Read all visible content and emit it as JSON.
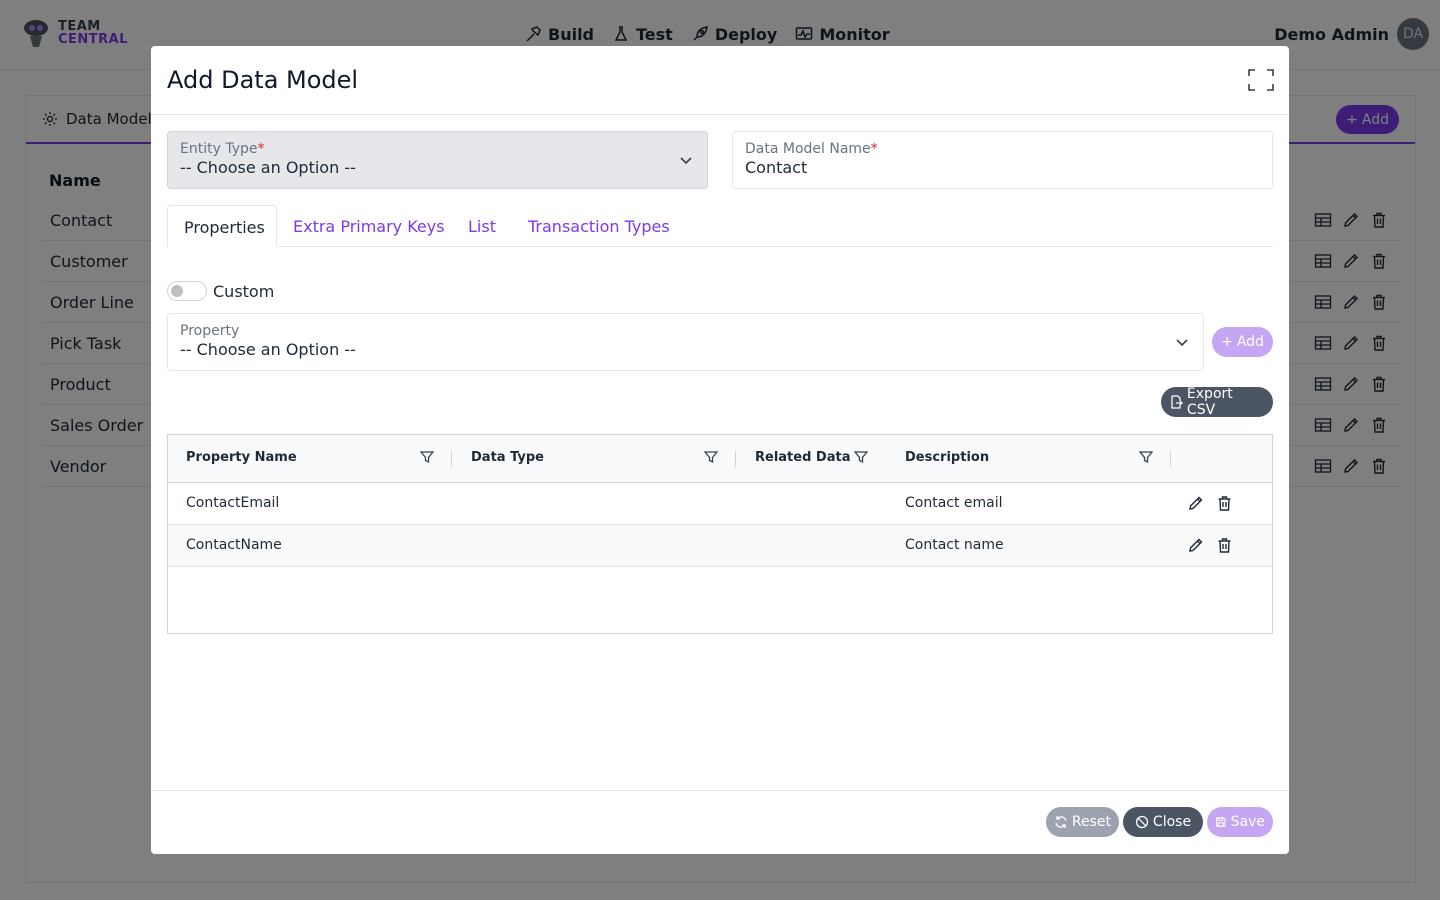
{
  "app": {
    "logo_line1": "TEAM",
    "logo_line2": "CENTRAL",
    "nav": [
      {
        "label": "Build",
        "icon": "hammer-icon"
      },
      {
        "label": "Test",
        "icon": "flask-icon"
      },
      {
        "label": "Deploy",
        "icon": "rocket-icon"
      },
      {
        "label": "Monitor",
        "icon": "monitor-icon"
      }
    ],
    "user_name": "Demo Admin",
    "user_initials": "DA"
  },
  "background": {
    "tab_label": "Data Model",
    "add_label": "Add",
    "column_header": "Name",
    "rows": [
      "Contact",
      "Customer",
      "Order Line",
      "Pick Task",
      "Product",
      "Sales Order",
      "Vendor"
    ]
  },
  "modal": {
    "title": "Add Data Model",
    "entity_type": {
      "label": "Entity Type",
      "required": "*",
      "value": "-- Choose an Option --"
    },
    "data_model_name": {
      "label": "Data Model Name",
      "required": "*",
      "value": "Contact"
    },
    "tabs": [
      "Properties",
      "Extra Primary Keys",
      "List",
      "Transaction Types"
    ],
    "active_tab": "Properties",
    "custom_toggle": {
      "label": "Custom",
      "on": false
    },
    "property": {
      "label": "Property",
      "value": "-- Choose an Option --"
    },
    "add_label": "Add",
    "export_label": "Export CSV",
    "table": {
      "columns": [
        "Property Name",
        "Data Type",
        "Related Data",
        "Description"
      ],
      "rows": [
        {
          "property_name": "ContactEmail",
          "data_type": "",
          "related_data": "",
          "description": "Contact email"
        },
        {
          "property_name": "ContactName",
          "data_type": "",
          "related_data": "",
          "description": "Contact name"
        }
      ]
    },
    "footer": {
      "reset": "Reset",
      "close": "Close",
      "save": "Save"
    }
  },
  "colors": {
    "accent": "#7c3aed",
    "accent_light": "#c4a6f2",
    "dark_button": "#4b5563",
    "overlay": "rgba(0,0,0,0.5)"
  }
}
